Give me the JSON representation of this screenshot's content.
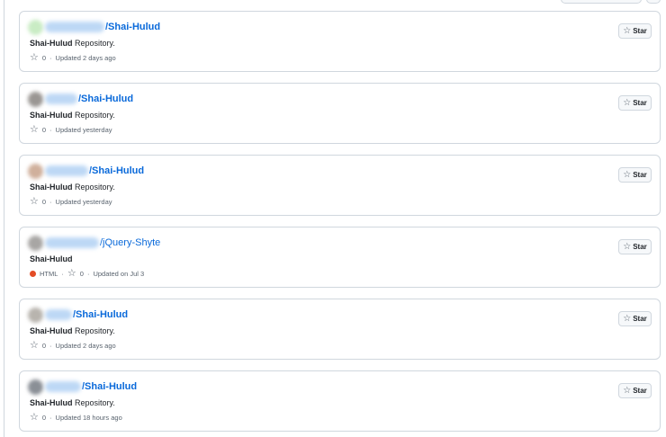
{
  "repos": [
    {
      "avatar_color": "#c9ecc4",
      "name": "/Shai-Hulud",
      "desc_bold": "Shai-Hulud",
      "desc_rest": " Repository.",
      "stars": "0",
      "language": "",
      "language_color": "",
      "updated": "Updated 2 days ago",
      "star_label": "Star"
    },
    {
      "avatar_color": "#9a9693",
      "name": "/Shai-Hulud",
      "desc_bold": "Shai-Hulud",
      "desc_rest": " Repository.",
      "stars": "0",
      "language": "",
      "language_color": "",
      "updated": "Updated yesterday",
      "star_label": "Star"
    },
    {
      "avatar_color": "#d0b09c",
      "name": "/Shai-Hulud",
      "desc_bold": "Shai-Hulud",
      "desc_rest": " Repository.",
      "stars": "0",
      "language": "",
      "language_color": "",
      "updated": "Updated yesterday",
      "star_label": "Star"
    },
    {
      "avatar_color": "#a8a6a4",
      "name": "/jQuery-Shyte",
      "desc_bold": "Shai-Hulud",
      "desc_rest": "",
      "stars": "0",
      "language": "HTML",
      "language_color": "#e34c26",
      "updated": "Updated on Jul 3",
      "star_label": "Star"
    },
    {
      "avatar_color": "#b8b4ae",
      "name": "/Shai-Hulud",
      "desc_bold": "Shai-Hulud",
      "desc_rest": " Repository.",
      "stars": "0",
      "language": "",
      "language_color": "",
      "updated": "Updated 2 days ago",
      "star_label": "Star"
    },
    {
      "avatar_color": "#8a8f96",
      "name": "/Shai-Hulud",
      "desc_bold": "Shai-Hulud",
      "desc_rest": " Repository.",
      "stars": "0",
      "language": "",
      "language_color": "",
      "updated": "Updated 18 hours ago",
      "star_label": "Star"
    }
  ]
}
